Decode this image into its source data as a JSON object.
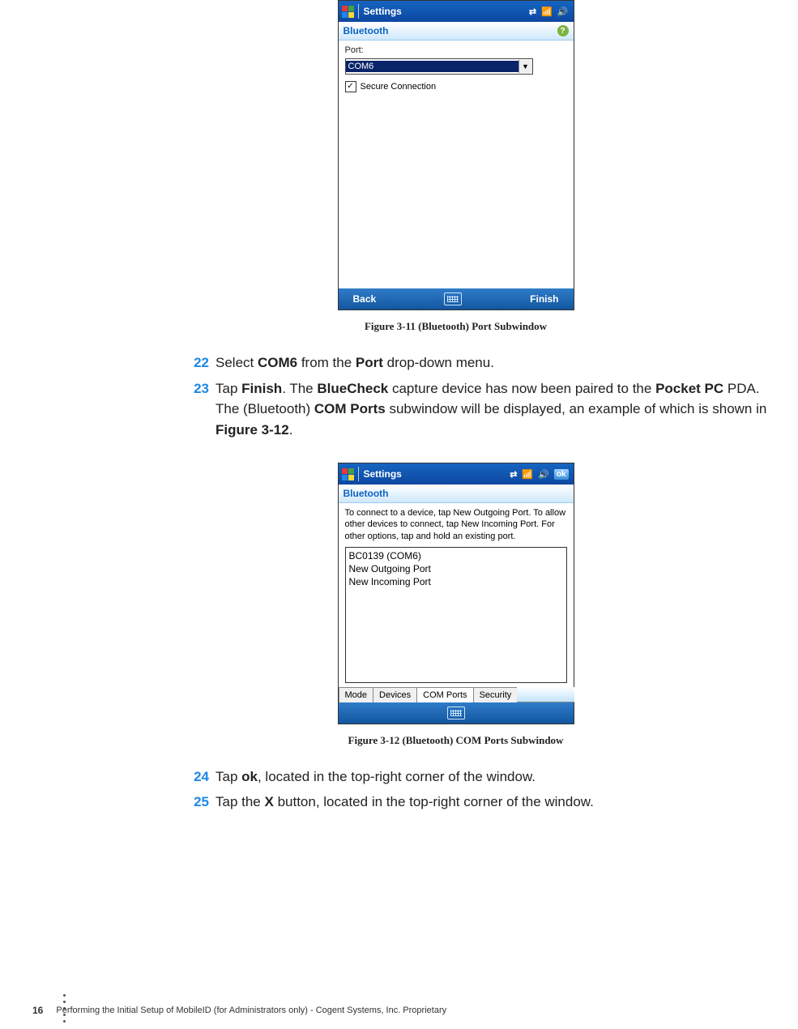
{
  "fig1": {
    "titlebar": {
      "label": "Settings"
    },
    "subtitle": "Bluetooth",
    "port_label": "Port:",
    "port_value": "COM6",
    "secure_label": "Secure Connection",
    "secure_checked": "✓",
    "back": "Back",
    "finish": "Finish",
    "caption": "Figure 3-11 (Bluetooth) Port Subwindow"
  },
  "steps_a": {
    "s22_num": "22",
    "s22_a": "Select ",
    "s22_b": "COM6",
    "s22_c": " from the ",
    "s22_d": "Port",
    "s22_e": " drop-down menu.",
    "s23_num": "23",
    "s23_a": "Tap ",
    "s23_b": "Finish",
    "s23_c": ". The ",
    "s23_d": "BlueCheck",
    "s23_e": " capture device has now been paired to the ",
    "s23_f": "Pocket PC",
    "s23_g": " PDA. The (Bluetooth) ",
    "s23_h": "COM Ports",
    "s23_i": " subwindow will be displayed, an example of which is shown in ",
    "s23_j": "Figure 3-12",
    "s23_k": "."
  },
  "fig2": {
    "titlebar": {
      "label": "Settings",
      "ok": "ok"
    },
    "subtitle": "Bluetooth",
    "instructions": "To connect to a device, tap New Outgoing Port. To allow other devices to connect, tap New Incoming Port. For other options, tap and hold an existing port.",
    "items": {
      "i0": "BC0139 (COM6)",
      "i1": "New Outgoing Port",
      "i2": "New Incoming Port"
    },
    "tabs": {
      "t0": "Mode",
      "t1": "Devices",
      "t2": "COM Ports",
      "t3": "Security"
    },
    "caption": "Figure 3-12 (Bluetooth) COM Ports Subwindow"
  },
  "steps_b": {
    "s24_num": "24",
    "s24_a": "Tap ",
    "s24_b": "ok",
    "s24_c": ", located in the top-right corner of the window.",
    "s25_num": "25",
    "s25_a": "Tap the ",
    "s25_b": "X",
    "s25_c": " button, located in the top-right corner of the window."
  },
  "footer": {
    "pagenum": "16",
    "text": "Performing the Initial Setup of MobileID (for Administrators only)  - Cogent Systems, Inc. Proprietary"
  }
}
